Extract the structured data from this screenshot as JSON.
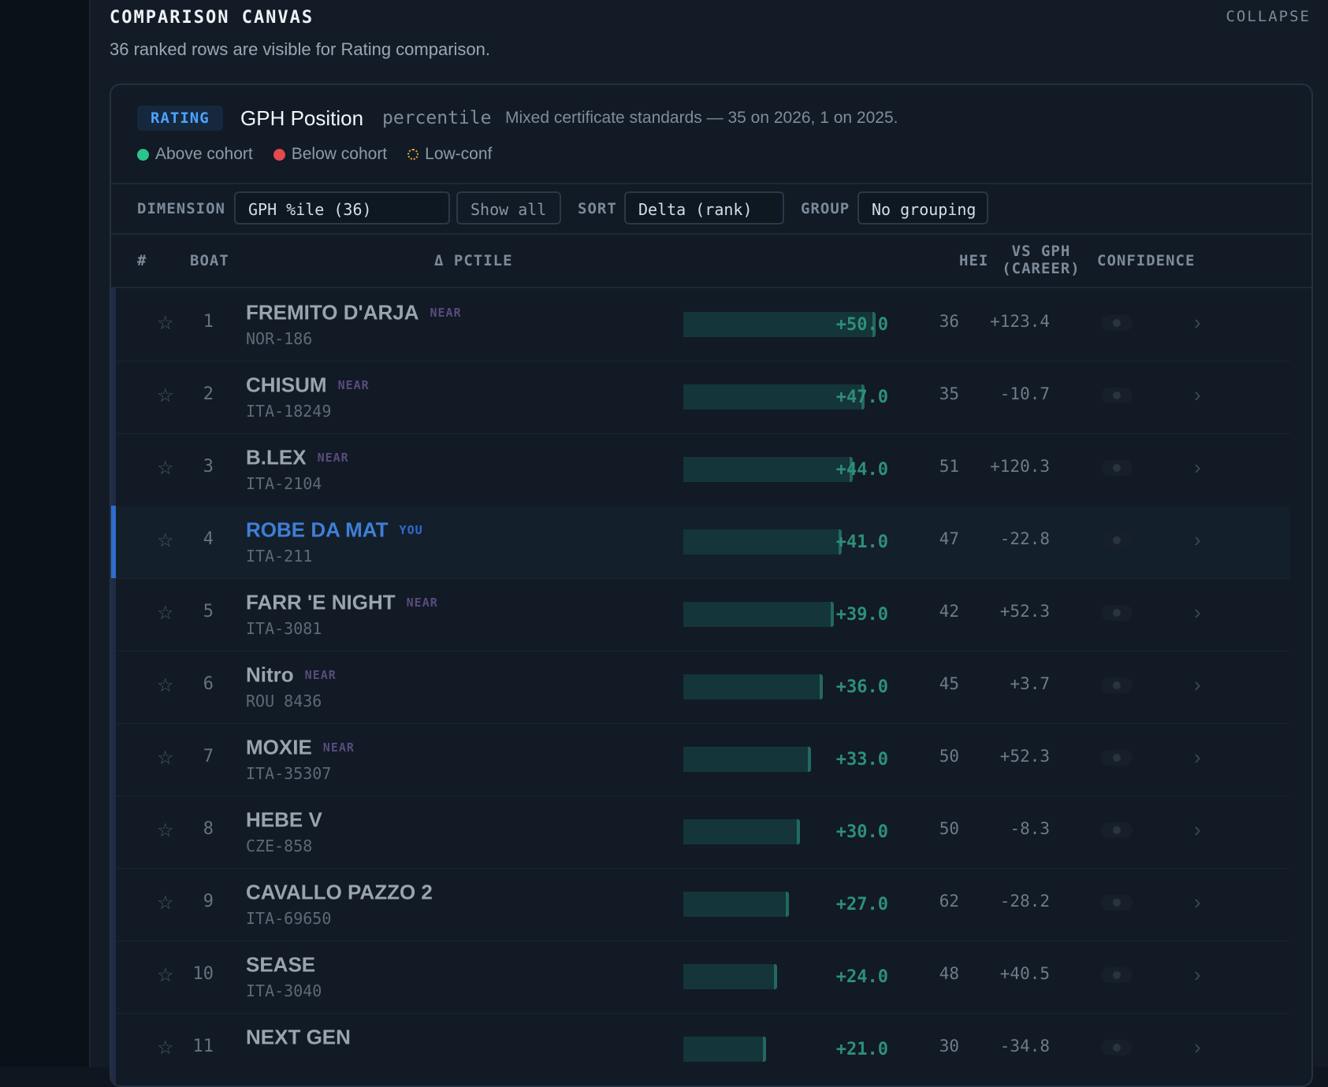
{
  "section": {
    "title": "COMPARISON CANVAS",
    "collapse_label": "COLLAPSE",
    "subtitle": "36 ranked rows are visible for Rating comparison."
  },
  "card": {
    "badge": "RATING",
    "metric_name": "GPH Position",
    "metric_unit": "percentile",
    "metric_note": "Mixed certificate standards — 35 on 2026, 1 on 2025.",
    "legend": [
      {
        "label": "Above cohort",
        "color": "#2bc48a"
      },
      {
        "label": "Below cohort",
        "color": "#e5484d"
      },
      {
        "label": "Low-conf",
        "color": "#e0a33a"
      }
    ]
  },
  "controls": {
    "dimension_label": "DIMENSION",
    "dimension_value": "GPH %ile (36)",
    "show_all_label": "Show all",
    "sort_label": "SORT",
    "sort_value": "Delta (rank)",
    "group_label": "GROUP",
    "group_value": "No grouping"
  },
  "columns": {
    "rank": "#",
    "boat": "BOAT",
    "delta": "Δ PCTILE",
    "hei": "HEI",
    "vs_gph_line1": "VS GPH",
    "vs_gph_line2": "(CAREER)",
    "confidence": "CONFIDENCE"
  },
  "rows": [
    {
      "rank": "1",
      "name": "FREMITO D'ARJA",
      "tag": "NEAR",
      "sail": "NOR-186",
      "delta": "+50.0",
      "delta_value": 50.0,
      "hei": "36",
      "vs_gph": "+123.4",
      "you": false
    },
    {
      "rank": "2",
      "name": "CHISUM",
      "tag": "NEAR",
      "sail": "ITA-18249",
      "delta": "+47.0",
      "delta_value": 47.0,
      "hei": "35",
      "vs_gph": "-10.7",
      "you": false
    },
    {
      "rank": "3",
      "name": "B.LEX",
      "tag": "NEAR",
      "sail": "ITA-2104",
      "delta": "+44.0",
      "delta_value": 44.0,
      "hei": "51",
      "vs_gph": "+120.3",
      "you": false
    },
    {
      "rank": "4",
      "name": "ROBE DA MAT",
      "tag": "YOU",
      "sail": "ITA-211",
      "delta": "+41.0",
      "delta_value": 41.0,
      "hei": "47",
      "vs_gph": "-22.8",
      "you": true
    },
    {
      "rank": "5",
      "name": "FARR 'E NIGHT",
      "tag": "NEAR",
      "sail": "ITA-3081",
      "delta": "+39.0",
      "delta_value": 39.0,
      "hei": "42",
      "vs_gph": "+52.3",
      "you": false
    },
    {
      "rank": "6",
      "name": "Nitro",
      "tag": "NEAR",
      "sail": "ROU 8436",
      "delta": "+36.0",
      "delta_value": 36.0,
      "hei": "45",
      "vs_gph": "+3.7",
      "you": false
    },
    {
      "rank": "7",
      "name": "MOXIE",
      "tag": "NEAR",
      "sail": "ITA-35307",
      "delta": "+33.0",
      "delta_value": 33.0,
      "hei": "50",
      "vs_gph": "+52.3",
      "you": false
    },
    {
      "rank": "8",
      "name": "HEBE V",
      "tag": "",
      "sail": "CZE-858",
      "delta": "+30.0",
      "delta_value": 30.0,
      "hei": "50",
      "vs_gph": "-8.3",
      "you": false
    },
    {
      "rank": "9",
      "name": "CAVALLO PAZZO 2",
      "tag": "",
      "sail": "ITA-69650",
      "delta": "+27.0",
      "delta_value": 27.0,
      "hei": "62",
      "vs_gph": "-28.2",
      "you": false
    },
    {
      "rank": "10",
      "name": "SEASE",
      "tag": "",
      "sail": "ITA-3040",
      "delta": "+24.0",
      "delta_value": 24.0,
      "hei": "48",
      "vs_gph": "+40.5",
      "you": false
    },
    {
      "rank": "11",
      "name": "NEXT GEN",
      "tag": "",
      "sail": "",
      "delta": "+21.0",
      "delta_value": 21.0,
      "hei": "30",
      "vs_gph": "-34.8",
      "you": false
    }
  ],
  "icons": {
    "star": "star-icon",
    "chevron": "chevron-right-icon"
  }
}
